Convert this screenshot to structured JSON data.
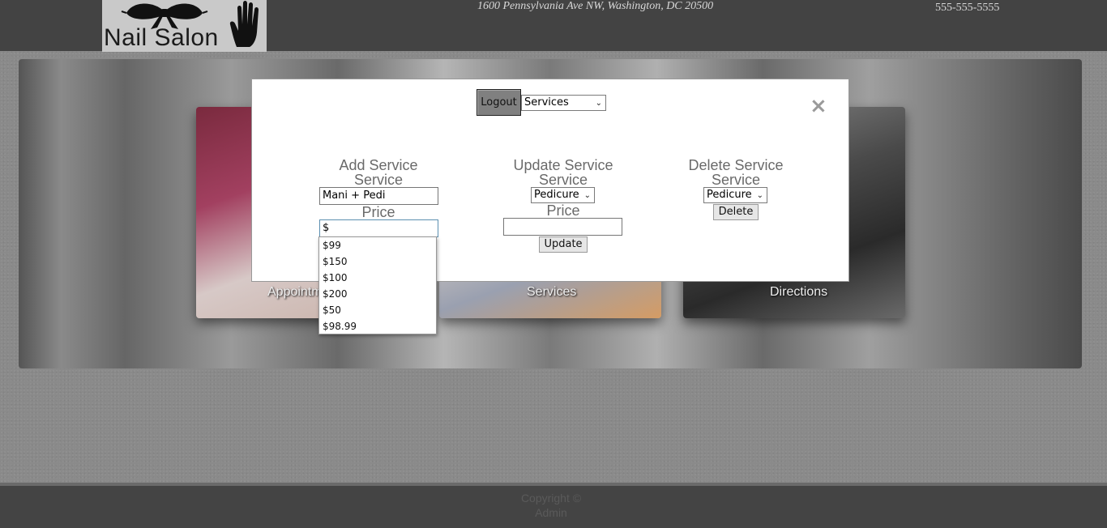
{
  "header": {
    "logo_text": "Nail Salon",
    "address": "1600 Pennsylvania Ave NW, Washington, DC 20500",
    "phone": "555-555-5555"
  },
  "cards": [
    {
      "label": "Appointments"
    },
    {
      "label": "Services"
    },
    {
      "label": "Directions"
    }
  ],
  "modal": {
    "logout_label": "Logout",
    "nav_select_value": "Services",
    "close_symbol": "×",
    "add": {
      "heading": "Add Service",
      "service_label": "Service",
      "service_value": "Mani + Pedi",
      "price_label": "Price",
      "price_value": "$",
      "price_suggestions": [
        "$99",
        "$150",
        "$100",
        "$200",
        "$50",
        "$98.99"
      ]
    },
    "update": {
      "heading": "Update Service",
      "service_label": "Service",
      "service_select_value": "Pedicure",
      "price_label": "Price",
      "price_value": "",
      "button_label": "Update"
    },
    "delete": {
      "heading": "Delete Service",
      "service_label": "Service",
      "service_select_value": "Pedicure",
      "button_label": "Delete"
    }
  },
  "footer": {
    "copyright_line1": "Copyright ©",
    "copyright_line2": "Admin"
  }
}
